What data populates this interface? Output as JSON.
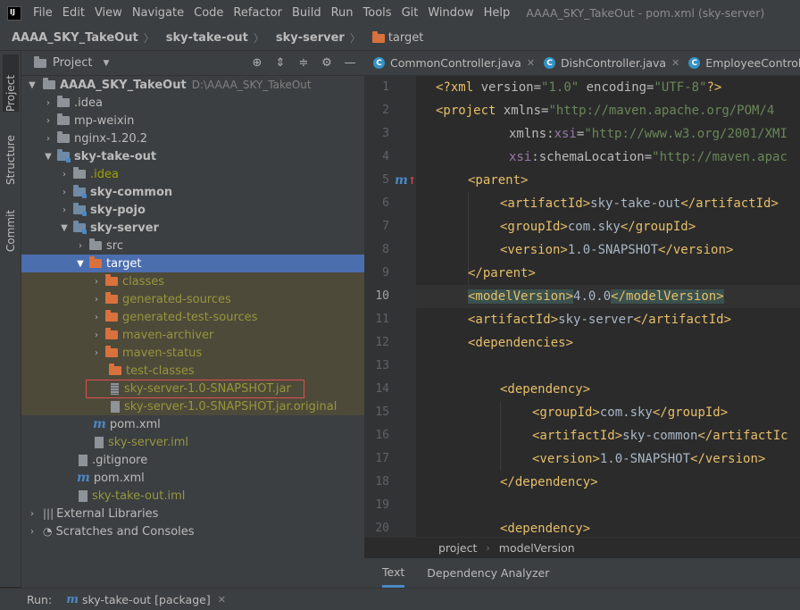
{
  "menubar": {
    "items": [
      "File",
      "Edit",
      "View",
      "Navigate",
      "Code",
      "Refactor",
      "Build",
      "Run",
      "Tools",
      "Git",
      "Window",
      "Help"
    ],
    "window_title": "AAAA_SKY_TakeOut - pom.xml (sky-server)"
  },
  "breadcrumbs": [
    "AAAA_SKY_TakeOut",
    "sky-take-out",
    "sky-server",
    "target"
  ],
  "side_tabs": [
    "Project",
    "Structure",
    "Commit"
  ],
  "project_panel": {
    "title": "Project"
  },
  "tree": [
    {
      "label": "AAAA_SKY_TakeOut",
      "path": "D:\\AAAA_SKY_TakeOut"
    },
    {
      "label": ".idea"
    },
    {
      "label": "mp-weixin"
    },
    {
      "label": "nginx-1.20.2"
    },
    {
      "label": "sky-take-out"
    },
    {
      "label": ".idea"
    },
    {
      "label": "sky-common"
    },
    {
      "label": "sky-pojo"
    },
    {
      "label": "sky-server"
    },
    {
      "label": "src"
    },
    {
      "label": "target"
    },
    {
      "label": "classes"
    },
    {
      "label": "generated-sources"
    },
    {
      "label": "generated-test-sources"
    },
    {
      "label": "maven-archiver"
    },
    {
      "label": "maven-status"
    },
    {
      "label": "test-classes"
    },
    {
      "label": "sky-server-1.0-SNAPSHOT.jar"
    },
    {
      "label": "sky-server-1.0-SNAPSHOT.jar.original"
    },
    {
      "label": "pom.xml"
    },
    {
      "label": "sky-server.iml"
    },
    {
      "label": ".gitignore"
    },
    {
      "label": "pom.xml"
    },
    {
      "label": "sky-take-out.iml"
    },
    {
      "label": "External Libraries"
    },
    {
      "label": "Scratches and Consoles"
    }
  ],
  "editor_tabs": [
    "CommonController.java",
    "DishController.java",
    "EmployeeController"
  ],
  "line_numbers": [
    "1",
    "2",
    "3",
    "4",
    "5",
    "6",
    "7",
    "8",
    "9",
    "10",
    "11",
    "12",
    "13",
    "14",
    "15",
    "16",
    "17",
    "18",
    "19",
    "20"
  ],
  "code": {
    "l1a": "<?xml ",
    "l1b": "version",
    "l1c": "=",
    "l1d": "\"1.0\"",
    "l1e": " encoding",
    "l1f": "=",
    "l1g": "\"UTF-8\"",
    "l1h": "?>",
    "l2a": "<project ",
    "l2b": "xmlns",
    "l2c": "=",
    "l2d": "\"http://maven.apache.org/POM/4",
    "l3a": "xmlns:",
    "l3b": "xsi",
    "l3c": "=",
    "l3d": "\"http://www.w3.org/2001/XMI",
    "l4a": "xsi",
    "l4b": ":schemaLocation",
    "l4c": "=",
    "l4d": "\"http://maven.apac",
    "l5a": "<parent>",
    "l6a": "<artifactId>",
    "l6b": "sky-take-out",
    "l6c": "</artifactId>",
    "l7a": "<groupId>",
    "l7b": "com.sky",
    "l7c": "</groupId>",
    "l8a": "<version>",
    "l8b": "1.0-SNAPSHOT",
    "l8c": "</version>",
    "l9a": "</parent>",
    "l10a": "<modelVersion>",
    "l10b": "4.0.0",
    "l10c": "</modelVersion>",
    "l11a": "<artifactId>",
    "l11b": "sky-server",
    "l11c": "</artifactId>",
    "l12a": "<dependencies>",
    "l14a": "<dependency>",
    "l15a": "<groupId>",
    "l15b": "com.sky",
    "l15c": "</groupId>",
    "l16a": "<artifactId>",
    "l16b": "sky-common",
    "l16c": "</artifactIc",
    "l17a": "<version>",
    "l17b": "1.0-SNAPSHOT",
    "l17c": "</version>",
    "l18a": "</dependency>",
    "l20a": "<dependency>"
  },
  "editor_breadcrumb": [
    "project",
    "modelVersion"
  ],
  "bottom_tabs": [
    "Text",
    "Dependency Analyzer"
  ],
  "run_bar": {
    "label": "Run:",
    "config": "sky-take-out [package]"
  },
  "colors": {
    "selection": "#4b6eaf",
    "ignored_bg": "#4d4a3a",
    "ignored_text": "#a0a000",
    "tag": "#e8bf6a",
    "attr_value": "#6a8759"
  }
}
